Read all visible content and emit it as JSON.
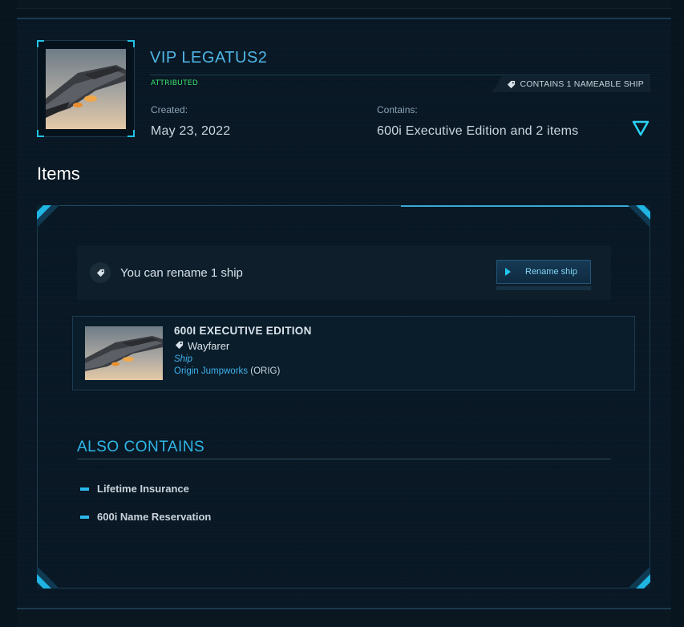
{
  "pledge": {
    "title": "VIP LEGATUS2",
    "status": "ATTRIBUTED",
    "nameable_badge": "CONTAINS 1 NAMEABLE SHIP",
    "created_label": "Created:",
    "created_value": "May 23, 2022",
    "contains_label": "Contains:",
    "contains_value": "600i Executive Edition and 2 items"
  },
  "items_section": {
    "title": "Items",
    "rename_banner": {
      "text": "You can rename 1 ship",
      "button_label": "Rename ship"
    },
    "ship": {
      "name": "600I EXECUTIVE EDITION",
      "custom_name": "Wayfarer",
      "type": "Ship",
      "manufacturer": "Origin Jumpworks",
      "manufacturer_code": "ORIG"
    },
    "also_contains": {
      "title": "ALSO CONTAINS",
      "items": [
        "Lifetime Insurance",
        "600i Name Reservation"
      ]
    }
  },
  "colors": {
    "accent": "#2fb7e8",
    "status_green": "#3be36a",
    "background": "#07131d"
  },
  "icons": [
    "tag-icon",
    "expand-triangle-icon",
    "play-icon",
    "ship-thumbnail"
  ]
}
